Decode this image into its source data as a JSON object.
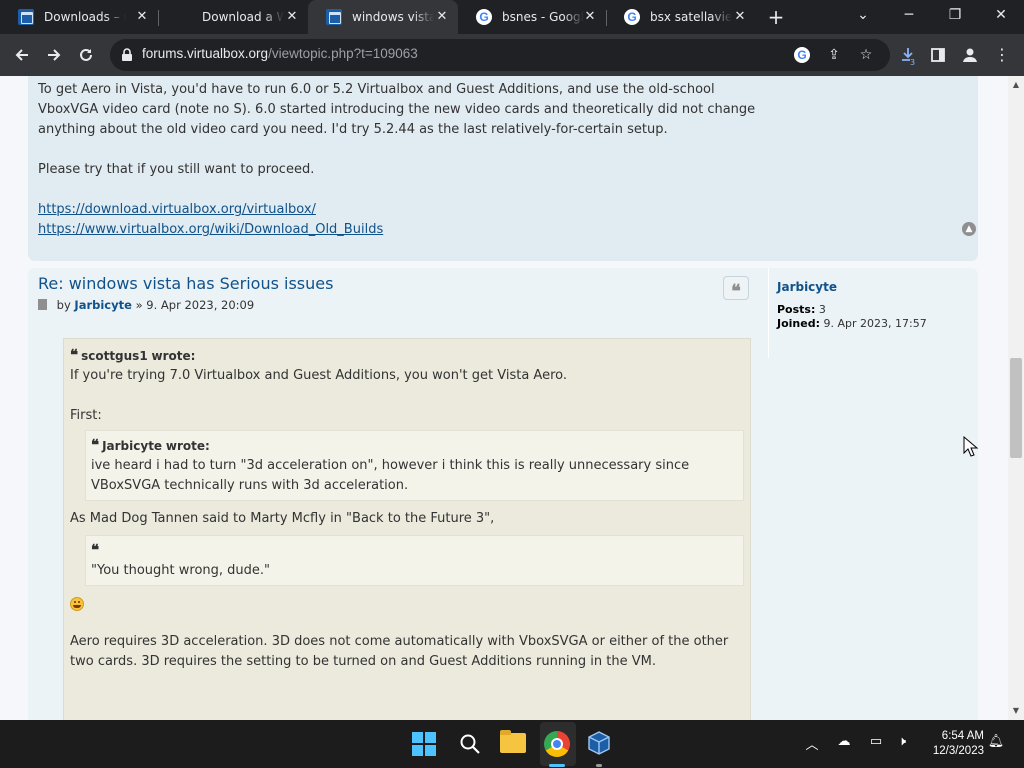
{
  "browser": {
    "tabs": [
      {
        "title": "Downloads – Oracle VM VirtualBox",
        "icon": "virtualbox-icon"
      },
      {
        "title": "Download a Windows",
        "icon": "microsoft-icon"
      },
      {
        "title": "windows vista has Serious issues",
        "icon": "virtualbox-icon",
        "active": true
      },
      {
        "title": "bsnes - Google Search",
        "icon": "google-icon"
      },
      {
        "title": "bsx satellaview - Google",
        "icon": "google-icon"
      }
    ],
    "new_tab": "+",
    "window_controls": {
      "tab_search": "⌄",
      "minimize": "─",
      "restore": "❐",
      "close": "✕"
    },
    "url_domain": "forums.virtualbox.org",
    "url_path": "/viewtopic.php?t=109063",
    "download_count": "3"
  },
  "post1": {
    "paragraph1": "To get Aero in Vista, you'd have to run 6.0 or 5.2 Virtualbox and Guest Additions, and use the old-school VboxVGA video card (note no S). 6.0 started introducing the new video cards and theoretically did not change anything about the old video card you need. I'd try 5.2.44 as the last relatively-for-certain setup.",
    "paragraph2": "Please try that if you still want to proceed.",
    "link1": "https://download.virtualbox.org/virtualbox/",
    "link2": "https://www.virtualbox.org/wiki/Download_Old_Builds"
  },
  "post2": {
    "title": "Re: windows vista has Serious issues",
    "by": "by",
    "author": "Jarbicyte",
    "separator": "»",
    "date": "9. Apr 2023, 20:09",
    "profile": {
      "username": "Jarbicyte",
      "posts_label": "Posts:",
      "posts_value": "3",
      "joined_label": "Joined:",
      "joined_value": "9. Apr 2023, 17:57"
    },
    "outer_quote": {
      "cite_author": "scottgus1",
      "cite_suffix": "wrote:",
      "line1": "If you're trying 7.0 Virtualbox and Guest Additions, you won't get Vista Aero.",
      "line2": "First:",
      "inner_quote": {
        "cite_author": "Jarbicyte",
        "cite_suffix": "wrote:",
        "text": "ive heard i had to turn \"3d acceleration on\", however i think this is really unnecessary since VBoxSVGA technically runs with 3d acceleration."
      },
      "line3": "As Mad Dog Tannen said to Marty Mcfly in \"Back to the Future 3\",",
      "movie_quote": "\"You thought wrong, dude.\"",
      "line4": "Aero requires 3D acceleration. 3D does not come automatically with VboxSVGA or either of the other two cards. 3D requires the setting to be turned on and Guest Additions running in the VM."
    }
  },
  "taskbar": {
    "time": "6:54 AM",
    "date": "12/3/2023"
  }
}
